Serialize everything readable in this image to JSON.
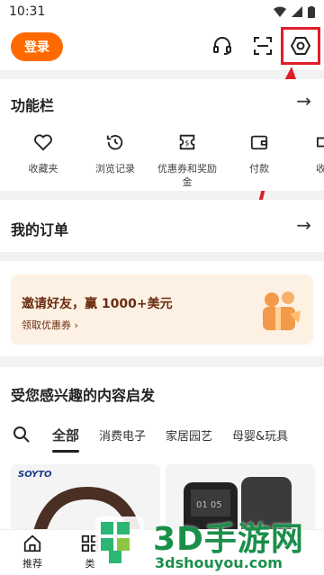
{
  "status": {
    "time": "10:31"
  },
  "header": {
    "login_label": "登录",
    "icons": [
      "headset-icon",
      "scan-icon",
      "settings-icon"
    ],
    "highlight_color": "#e11d2a"
  },
  "function_bar": {
    "title": "功能栏",
    "items": [
      {
        "label": "收藏夹",
        "icon": "heart-icon"
      },
      {
        "label": "浏览记录",
        "icon": "history-icon"
      },
      {
        "label": "优惠券和奖励",
        "label2": "金",
        "icon": "coupon-icon"
      },
      {
        "label": "付款",
        "icon": "wallet-icon"
      },
      {
        "label": "收货",
        "icon": "truck-icon"
      }
    ]
  },
  "orders": {
    "title": "我的订单"
  },
  "promo": {
    "title": "邀请好友，赢 1000+美元",
    "link": "领取优惠券",
    "link_arrow": "›"
  },
  "content": {
    "title": "受您感兴趣的内容启发",
    "tabs": [
      "全部",
      "消费电子",
      "家居园艺",
      "母婴&玩具"
    ],
    "product_brand": "SOYTO"
  },
  "bottom_nav": {
    "items": [
      {
        "label": "推荐",
        "icon": "home-icon"
      },
      {
        "label": "类",
        "icon": "category-icon"
      }
    ]
  },
  "watermark": {
    "text": "3D手游网",
    "url": "3dshouyou.com"
  },
  "colors": {
    "accent": "#ff6a00",
    "promo_bg": "#fdf1e4",
    "annotation": "#e11d2a"
  }
}
